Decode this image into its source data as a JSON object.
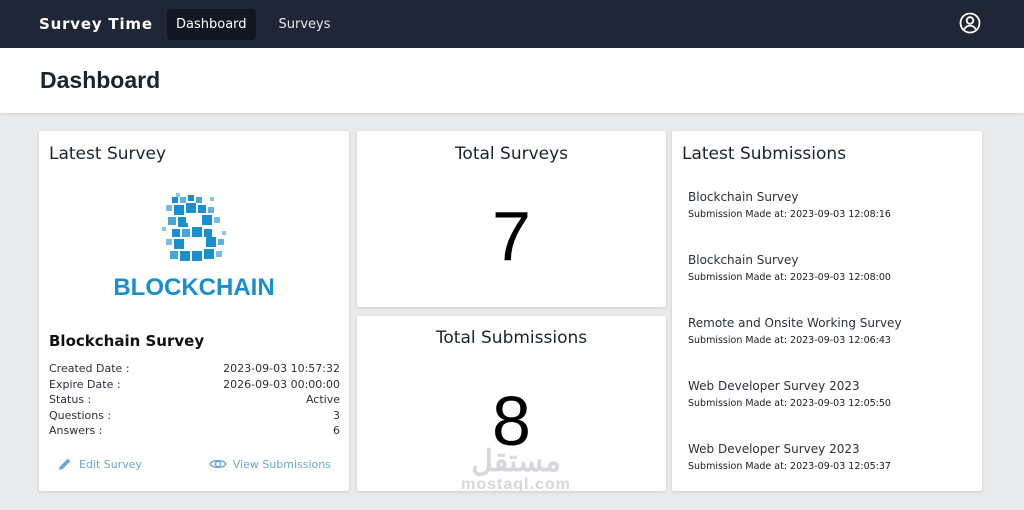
{
  "nav": {
    "brand": "Survey Time",
    "links": [
      "Dashboard",
      "Surveys"
    ],
    "user_icon": "user-circle-icon"
  },
  "header": {
    "title": "Dashboard"
  },
  "latest_survey": {
    "card_title": "Latest Survey",
    "logo_text": "BLOCKCHAIN",
    "logo_color": "#1a8fd0",
    "name": "Blockchain Survey",
    "fields": [
      {
        "label": "Created Date :",
        "value": "2023-09-03 10:57:32"
      },
      {
        "label": "Expire Date :",
        "value": "2026-09-03 00:00:00"
      },
      {
        "label": "Status :",
        "value": "Active"
      },
      {
        "label": "Questions :",
        "value": "3"
      },
      {
        "label": "Answers :",
        "value": "6"
      }
    ],
    "edit_label": "Edit Survey",
    "view_label": "View Submissions",
    "action_color": "#6aa6d8"
  },
  "total_surveys": {
    "title": "Total Surveys",
    "value": "7"
  },
  "total_submissions": {
    "title": "Total Submissions",
    "value": "8"
  },
  "watermark": {
    "arabic": "مستقل",
    "latin": "mostaql.com"
  },
  "latest_submissions": {
    "card_title": "Latest Submissions",
    "items": [
      {
        "name": "Blockchain Survey",
        "time": "Submission Made at: 2023-09-03 12:08:16"
      },
      {
        "name": "Blockchain Survey",
        "time": "Submission Made at: 2023-09-03 12:08:00"
      },
      {
        "name": "Remote and Onsite Working Survey",
        "time": "Submission Made at: 2023-09-03 12:06:43"
      },
      {
        "name": "Web Developer Survey 2023",
        "time": "Submission Made at: 2023-09-03 12:05:50"
      },
      {
        "name": "Web Developer Survey 2023",
        "time": "Submission Made at: 2023-09-03 12:05:37"
      }
    ]
  },
  "colors": {
    "nav_bg": "#1f2636",
    "nav_active": "#111723",
    "page_bg": "#e9eaec"
  }
}
